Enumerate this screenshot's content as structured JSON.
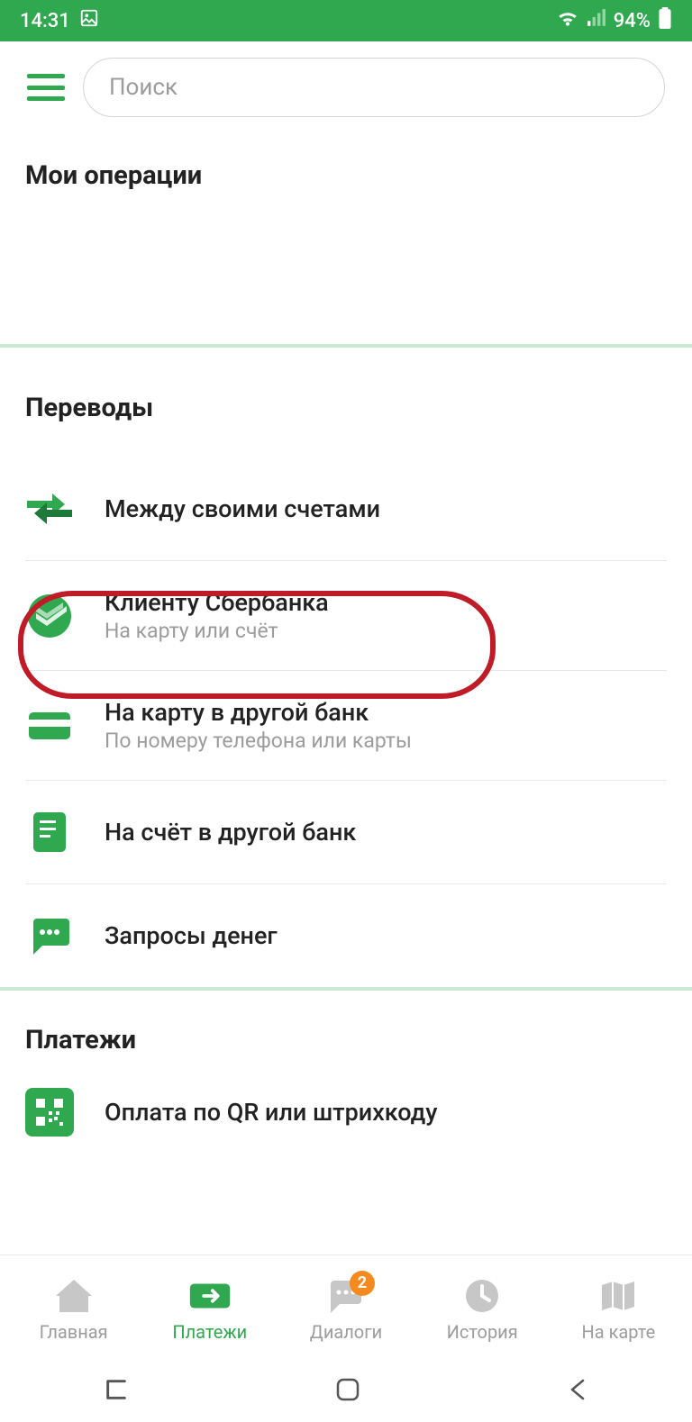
{
  "status": {
    "time": "14:31",
    "battery": "94%"
  },
  "search": {
    "placeholder": "Поиск"
  },
  "sections": {
    "myops": "Мои операции",
    "transfers": "Переводы",
    "payments": "Платежи"
  },
  "transfers": [
    {
      "title": "Между своими счетами",
      "subtitle": ""
    },
    {
      "title": "Клиенту Сбербанка",
      "subtitle": "На карту или счёт"
    },
    {
      "title": "На карту в другой банк",
      "subtitle": "По номеру телефона или карты"
    },
    {
      "title": "На счёт в другой банк",
      "subtitle": ""
    },
    {
      "title": "Запросы денег",
      "subtitle": ""
    }
  ],
  "payments": [
    {
      "title": "Оплата по QR или штрихкоду"
    }
  ],
  "nav": {
    "home": "Главная",
    "payments": "Платежи",
    "dialogs": "Диалоги",
    "history": "История",
    "map": "На карте",
    "badge": "2"
  }
}
